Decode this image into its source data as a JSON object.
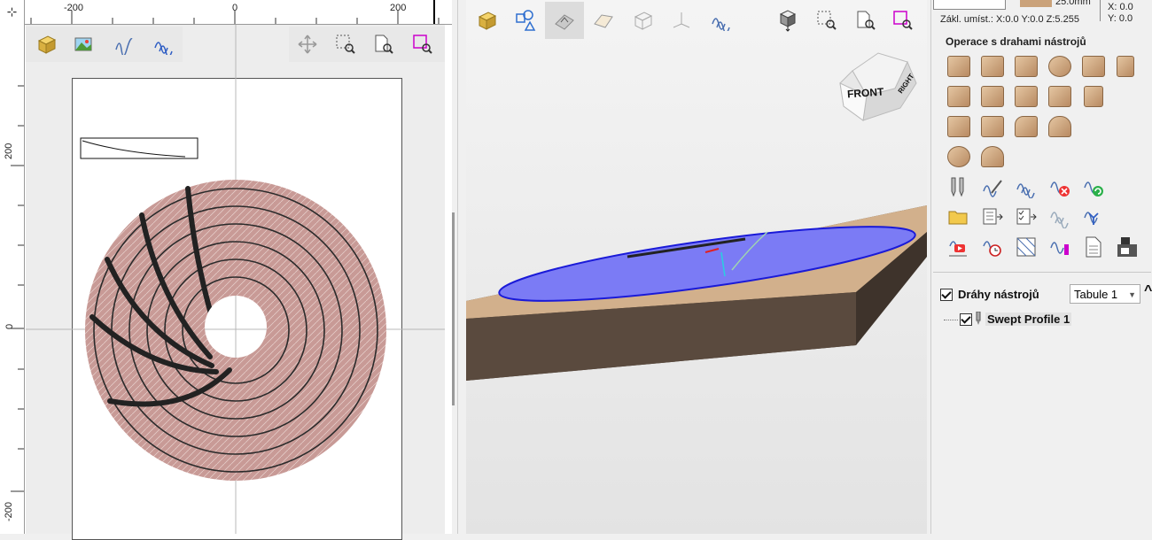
{
  "ruler_top": {
    "labels": [
      "-200",
      "0",
      "200"
    ]
  },
  "ruler_left": {
    "labels": [
      "200",
      "0",
      "-200"
    ]
  },
  "toolbar2d": {
    "left_icons": [
      "material-box-icon",
      "bitmap-icon",
      "toolpath-icon",
      "toolpath-blue-icon"
    ],
    "right_icons": [
      "pan-icon",
      "zoom-box-icon",
      "zoom-out-icon",
      "zoom-selection-icon"
    ]
  },
  "toolbar3d": {
    "icons": [
      "material-box-icon",
      "shapes-icon",
      "render-icon",
      "plane-icon",
      "wireframe-icon",
      "axes-icon",
      "toolpath-icon",
      "view-cube-icon",
      "zoom-box-icon",
      "zoom-out-icon",
      "zoom-selection-icon"
    ]
  },
  "viewcube": {
    "front": "FRONT",
    "right": "RIGHT"
  },
  "right_panel": {
    "thickness": "25.0mm",
    "x": "X: 0.0",
    "y": "Y: 0.0",
    "origin": "Zákl. umíst.: X:0.0 Y:0.0 Z:5.255",
    "section_title": "Operace s drahami nástrojů",
    "toolpaths_label": "Dráhy nástrojů",
    "sheet_select": "Tabule 1",
    "tree_item": "Swept Profile 1"
  },
  "colors": {
    "disc": "#c89a96",
    "ellipse": "#7b7bf5",
    "accent": "#cc00cc"
  }
}
